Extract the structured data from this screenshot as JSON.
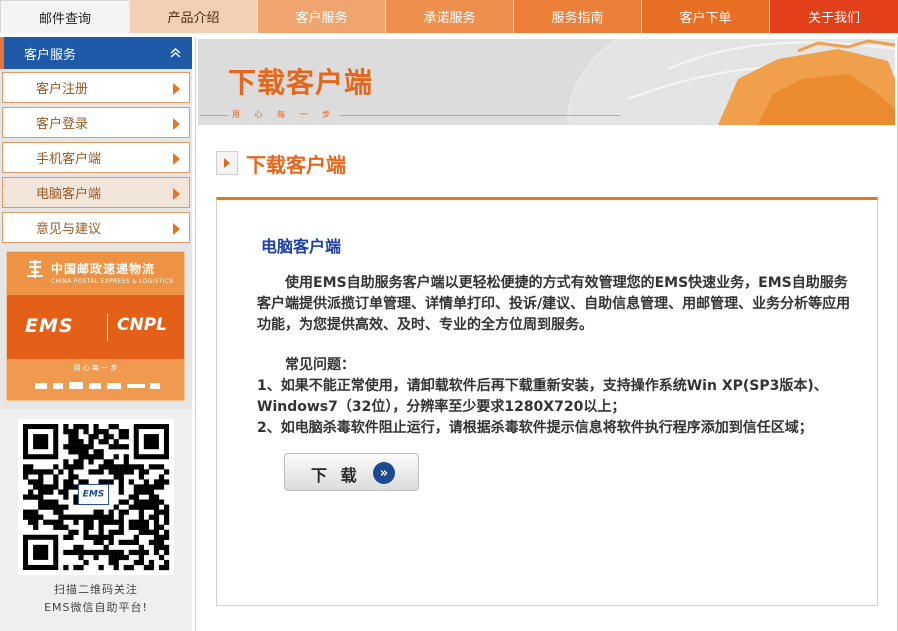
{
  "nav": {
    "tabs": [
      {
        "label": "邮件查询"
      },
      {
        "label": "产品介绍"
      },
      {
        "label": "客户服务"
      },
      {
        "label": "承诺服务"
      },
      {
        "label": "服务指南"
      },
      {
        "label": "客户下单"
      },
      {
        "label": "关于我们"
      }
    ]
  },
  "sidebar": {
    "header": "客户服务",
    "items": [
      {
        "label": "客户注册"
      },
      {
        "label": "客户登录"
      },
      {
        "label": "手机客户端"
      },
      {
        "label": "电脑客户端",
        "active": true
      },
      {
        "label": "意见与建议"
      }
    ],
    "banner": {
      "cn_name": "中国邮政速递物流",
      "en_name": "CHINA POSTAL EXPRESS & LOGISTICS",
      "ems_logo": "EMS",
      "cnpl_logo": "CNPL",
      "slogan": "用 心 每 一 步"
    },
    "qr": {
      "caption_line1": "扫描二维码关注",
      "caption_line2": "EMS微信自助平台!"
    }
  },
  "hero": {
    "title": "下载客户端",
    "slogan": "用 心 每 一 步"
  },
  "main": {
    "page_title": "下载客户端",
    "subtitle": "电脑客户端",
    "intro": "使用EMS自助服务客户端以更轻松便捷的方式有效管理您的EMS快速业务，EMS自助服务客户端提供派揽订单管理、详情单打印、投诉/建议、自助信息管理、用邮管理、业务分析等应用功能，为您提供高效、及时、专业的全方位周到服务。",
    "faq_heading": "常见问题：",
    "faq_1": "1、如果不能正常使用，请卸载软件后再下载重新安装，支持操作系统Win XP(SP3版本)、Windows7（32位），分辨率至少要求1280X720以上；",
    "faq_2": "2、如电脑杀毒软件阻止运行，请根据杀毒软件提示信息将软件执行程序添加到信任区域；",
    "download_label": "下 载"
  },
  "colors": {
    "accent": "#e8661a",
    "nav_blue": "#1e5aa8",
    "title_blue": "#1c3fa8"
  }
}
